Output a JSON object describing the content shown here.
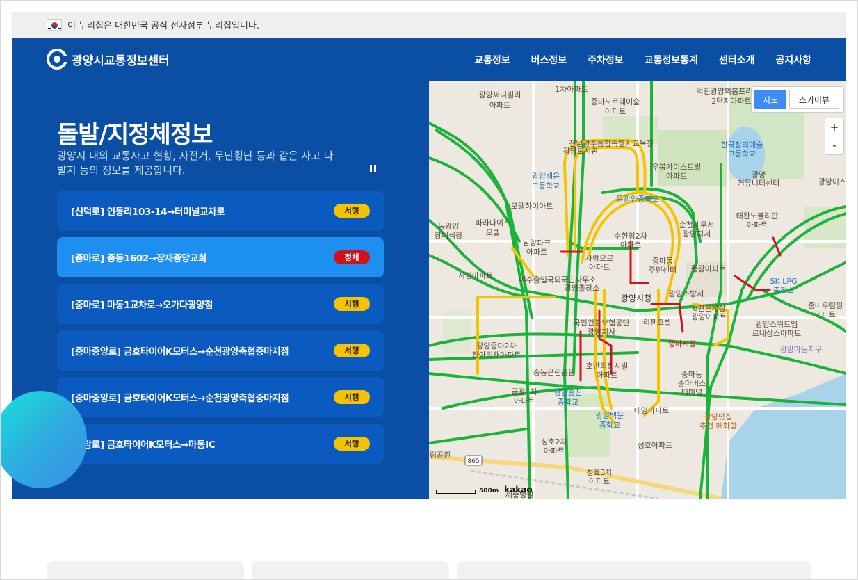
{
  "gov_banner": {
    "text": "이 누리집은 대한민국 공식 전자정부 누리집입니다."
  },
  "header": {
    "logo_text": "광양시교통정보센터",
    "nav": [
      "교통정보",
      "버스정보",
      "주차정보",
      "교통정보통계",
      "센터소개",
      "공지사항"
    ]
  },
  "hero": {
    "title": "돌발/지정체정보",
    "description": "광양시 내의 교통사고 현황, 자전거, 무단횡단 등과 같은 사고 다발지 등의 정보를 제공합니다."
  },
  "incidents": [
    {
      "label": "[신덕로] 인동리103-14→터미널교차로",
      "status": "서행"
    },
    {
      "label": "[중마로] 중동1602→장재중앙교회",
      "status": "정체",
      "active": true
    },
    {
      "label": "[중마로] 마동1교차로→오가다광양점",
      "status": "서행"
    },
    {
      "label": "[중마중앙로] 금호타이어K모터스→순천광양축협중마지점",
      "status": "서행"
    },
    {
      "label": "[중마중앙로] 금호타이어K모터스→순천광양축협중마지점",
      "status": "서행"
    },
    {
      "label": "[청암로] 금호타이어K모터스→마동IC",
      "status": "서행"
    }
  ],
  "map": {
    "toggle_map": "지도",
    "toggle_skyview": "스카이뷰",
    "zoom_in": "+",
    "zoom_out": "-",
    "scale_label": "500m",
    "provider": "kakao",
    "road_number": "865",
    "labels": [
      "1차아파트",
      "광양써니빌리",
      "아파트",
      "중마노르웨이숲",
      "아파트",
      "덕진광양의봄프리미엄",
      "2단지아파트",
      "전남광주통합특별시교육청",
      "광양도서관",
      "한국창의예술",
      "고등학교",
      "우봉카이스트빌",
      "아파트",
      "광양백운",
      "고등학교",
      "광양",
      "커뮤니티센터",
      "광양이스트",
      "모델하이아트",
      "동광양중학교",
      "태완노블리안",
      "아파트",
      "파라다이스",
      "모텔",
      "순천세무서",
      "광양지서",
      "동광양",
      "장례식장",
      "남양파크",
      "아파트",
      "수현임2차",
      "아파트",
      "사랑으로",
      "아파트",
      "중마동",
      "주민센터",
      "동광아파트",
      "SK LPG",
      "충전소",
      "시영아파트",
      "여수출입국외국인사무소",
      "광양출장소",
      "광양시청",
      "광양소방서",
      "e편한세상",
      "광양아파트",
      "중마우림필",
      "아파트",
      "국민건강보험공단",
      "광양지사",
      "리첸호텔",
      "광양스위트엠",
      "르네상스아파트",
      "중마시장",
      "광양마동지구",
      "광양중마2차",
      "진아리채아파트",
      "중동근린공원",
      "호반리젠시빌",
      "아파트",
      "중마동",
      "중마버스",
      "터미널",
      "금광1차",
      "아파트",
      "광양중진",
      "중학교",
      "광양백운",
      "중학교",
      "태영아파트",
      "광양맛집",
      "추천 매화향",
      "성호2차",
      "아파트",
      "성호아파트",
      "림공원",
      "성호3차",
      "아파트",
      "세종병원"
    ]
  },
  "colors": {
    "hero_bg": "#0b4fa5",
    "item_bg": "#0a5ac0",
    "item_active_bg": "#1c8ff0",
    "slow": "#f5c400",
    "jam": "#d0121b",
    "smooth": "#1cb33a"
  }
}
